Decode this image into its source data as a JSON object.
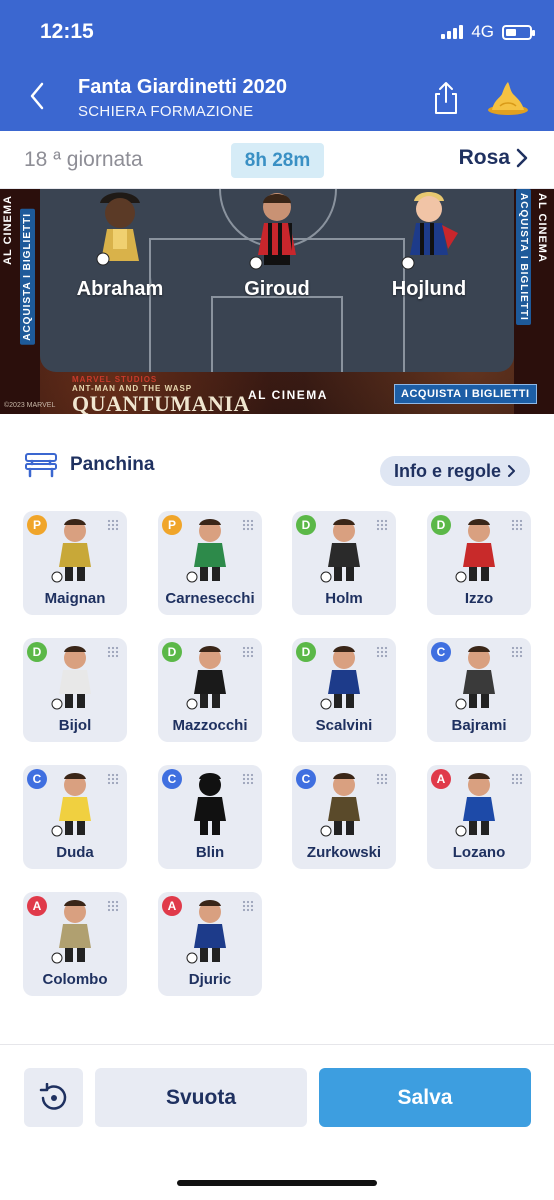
{
  "status_bar": {
    "time": "12:15",
    "network": "4G"
  },
  "header": {
    "title": "Fanta Giardinetti 2020",
    "subtitle": "SCHIERA FORMAZIONE",
    "back_icon": "chevron-left-icon",
    "share_icon": "share-icon",
    "menu_icon": "pile-icon"
  },
  "round_bar": {
    "round_label": "18 ª giornata",
    "timer": "8h 28m",
    "rosa_label": "Rosa"
  },
  "pitch": {
    "players": [
      {
        "name": "Abraham"
      },
      {
        "name": "Giroud"
      },
      {
        "name": "Hojlund"
      }
    ],
    "ad": {
      "side_text": "AL CINEMA",
      "side_cta": "ACQUISTA I BIGLIETTI",
      "studio": "MARVEL STUDIOS",
      "film_sub": "ANT-MAN AND THE WASP",
      "film_title": "QUANTUMANIA",
      "cinema": "AL CINEMA",
      "cta": "ACQUISTA I BIGLIETTI",
      "copyright": "©2023 MARVEL"
    }
  },
  "bench": {
    "title": "Panchina",
    "info_label": "Info e regole",
    "players": [
      {
        "role": "P",
        "name": "Maignan"
      },
      {
        "role": "P",
        "name": "Carnesecchi"
      },
      {
        "role": "D",
        "name": "Holm"
      },
      {
        "role": "D",
        "name": "Izzo"
      },
      {
        "role": "D",
        "name": "Bijol"
      },
      {
        "role": "D",
        "name": "Mazzocchi"
      },
      {
        "role": "D",
        "name": "Scalvini"
      },
      {
        "role": "C",
        "name": "Bajrami"
      },
      {
        "role": "C",
        "name": "Duda"
      },
      {
        "role": "C",
        "name": "Blin"
      },
      {
        "role": "C",
        "name": "Zurkowski"
      },
      {
        "role": "A",
        "name": "Lozano"
      },
      {
        "role": "A",
        "name": "Colombo"
      },
      {
        "role": "A",
        "name": "Djuric"
      }
    ]
  },
  "actions": {
    "undo_icon": "undo-icon",
    "clear_label": "Svuota",
    "save_label": "Salva"
  },
  "colors": {
    "header_bg": "#3b67d0",
    "role_P": "#f0a52a",
    "role_D": "#5bb848",
    "role_C": "#3f6fe0",
    "role_A": "#e03a4a",
    "save_button": "#3d9ee0",
    "text_dark": "#1f3160"
  }
}
